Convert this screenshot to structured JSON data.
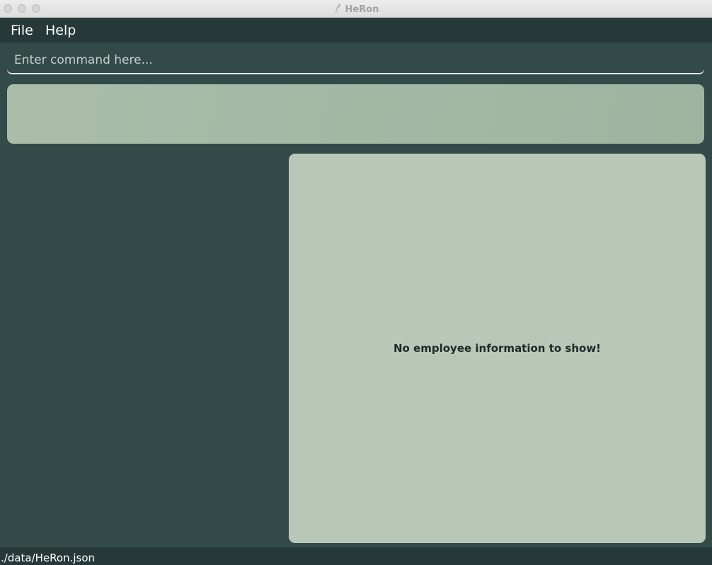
{
  "window": {
    "title": "HeRon",
    "icon": "heron-bird-icon"
  },
  "menu": {
    "items": [
      {
        "label": "File"
      },
      {
        "label": "Help"
      }
    ]
  },
  "command_box": {
    "value": "",
    "placeholder": "Enter command here..."
  },
  "result_display": {
    "text": ""
  },
  "detail_panel": {
    "empty_message": "No employee information to show!"
  },
  "status_bar": {
    "save_location": "./data/HeRon.json"
  },
  "colors": {
    "background": "#324A48",
    "menubar": "#263938",
    "result_display": "#A3B9A3",
    "detail_panel": "#B9C7B9",
    "text_light": "#FFFFFF",
    "text_dark": "#1F2A28"
  }
}
